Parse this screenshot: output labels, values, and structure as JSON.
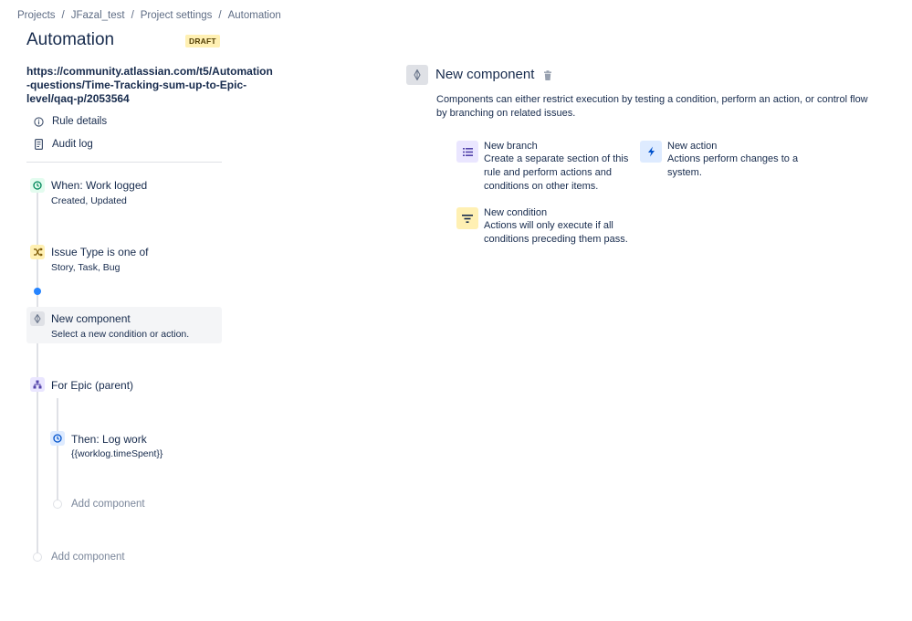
{
  "breadcrumbs": [
    "Projects",
    "JFazal_test",
    "Project settings",
    "Automation"
  ],
  "breadcrumb_separator": "/",
  "page": {
    "title": "Automation",
    "status_badge": "DRAFT"
  },
  "rule": {
    "name": "https://community.atlassian.com/t5/Automation-questions/Time-Tracking-sum-up-to-Epic-level/qaq-p/2053564"
  },
  "sidebar_links": [
    {
      "label": "Rule details",
      "icon": "info-icon"
    },
    {
      "label": "Audit log",
      "icon": "document-icon"
    }
  ],
  "flow": {
    "trigger": {
      "title": "When: Work logged",
      "subtitle": "Created, Updated",
      "icon": "clock-icon",
      "color": "#00875a",
      "bg": "#e3fcef"
    },
    "condition": {
      "title": "Issue Type is one of",
      "subtitle": "Story, Task, Bug",
      "icon": "shuffle-icon",
      "color": "#7a5500",
      "bg": "#fff0b3"
    },
    "new_component": {
      "title": "New component",
      "subtitle": "Select a new condition or action.",
      "icon": "diamond-icon"
    },
    "branch": {
      "title": "For Epic (parent)",
      "icon": "branch-icon",
      "color": "#5243aa",
      "bg": "#eae6ff"
    },
    "action": {
      "title": "Then: Log work",
      "subtitle": "{{worklog.timeSpent}}",
      "icon": "clock-icon",
      "color": "#0052cc",
      "bg": "#deebff"
    },
    "add_inner": "Add component",
    "add_outer": "Add component"
  },
  "panel": {
    "title": "New component",
    "description": "Components can either restrict execution by testing a condition, perform an action, or control flow by branching on related issues.",
    "options": [
      {
        "title": "New branch",
        "desc": "Create a separate section of this rule and perform actions and conditions on other items.",
        "icon": "list-icon",
        "bg": "#eae6ff",
        "color": "#5243aa"
      },
      {
        "title": "New action",
        "desc": "Actions perform changes to a system.",
        "icon": "bolt-icon",
        "bg": "#deebff",
        "color": "#0052cc"
      },
      {
        "title": "New condition",
        "desc": "Actions will only execute if all conditions preceding them pass.",
        "icon": "filter-icon",
        "bg": "#fff0b3",
        "color": "#172b4d"
      }
    ]
  }
}
